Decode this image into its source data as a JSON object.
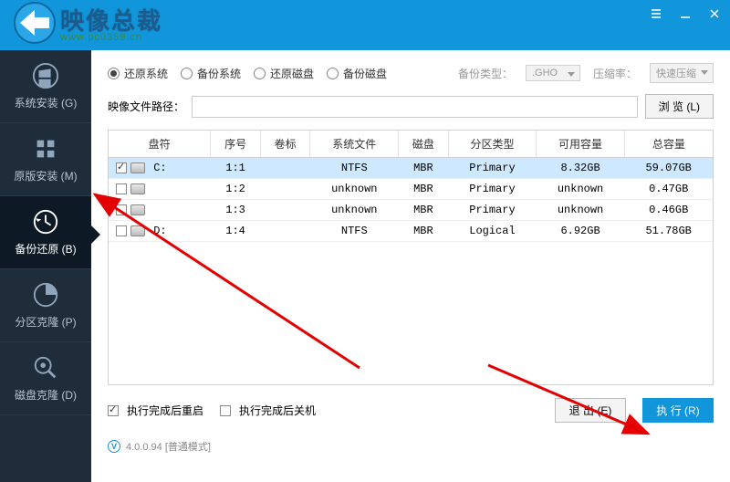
{
  "logo": {
    "text": "映像总裁",
    "url": "www.pc0359.cn"
  },
  "sidebar": {
    "items": [
      {
        "label": "系统安装 (G)"
      },
      {
        "label": "原版安装 (M)"
      },
      {
        "label": "备份还原 (B)"
      },
      {
        "label": "分区克隆 (P)"
      },
      {
        "label": "磁盘克隆 (D)"
      }
    ]
  },
  "opts": {
    "restore_sys": "还原系统",
    "backup_sys": "备份系统",
    "restore_disk": "还原磁盘",
    "backup_disk": "备份磁盘",
    "backup_type_label": "备份类型：",
    "backup_type_value": ".GHO",
    "compress_label": "压缩率：",
    "compress_value": "快速压缩"
  },
  "path": {
    "label": "映像文件路径：",
    "value": "",
    "browse": "浏 览 (L)"
  },
  "table": {
    "headers": [
      "盘符",
      "序号",
      "卷标",
      "系统文件",
      "磁盘",
      "分区类型",
      "可用容量",
      "总容量"
    ],
    "rows": [
      {
        "checked": true,
        "drive": "C:",
        "seq": "1:1",
        "vol": "",
        "fs": "NTFS",
        "disk": "MBR",
        "ptype": "Primary",
        "free": "8.32GB",
        "total": "59.07GB"
      },
      {
        "checked": false,
        "drive": "",
        "seq": "1:2",
        "vol": "",
        "fs": "unknown",
        "disk": "MBR",
        "ptype": "Primary",
        "free": "unknown",
        "total": "0.47GB"
      },
      {
        "checked": false,
        "drive": "",
        "seq": "1:3",
        "vol": "",
        "fs": "unknown",
        "disk": "MBR",
        "ptype": "Primary",
        "free": "unknown",
        "total": "0.46GB"
      },
      {
        "checked": false,
        "drive": "D:",
        "seq": "1:4",
        "vol": "",
        "fs": "NTFS",
        "disk": "MBR",
        "ptype": "Logical",
        "free": "6.92GB",
        "total": "51.78GB"
      }
    ]
  },
  "footer": {
    "opt_restart": "执行完成后重启",
    "opt_shutdown": "执行完成后关机",
    "exit": "退 出 (E)",
    "run": "执 行 (R)"
  },
  "version": {
    "text": "4.0.0.94 [普通模式]"
  }
}
